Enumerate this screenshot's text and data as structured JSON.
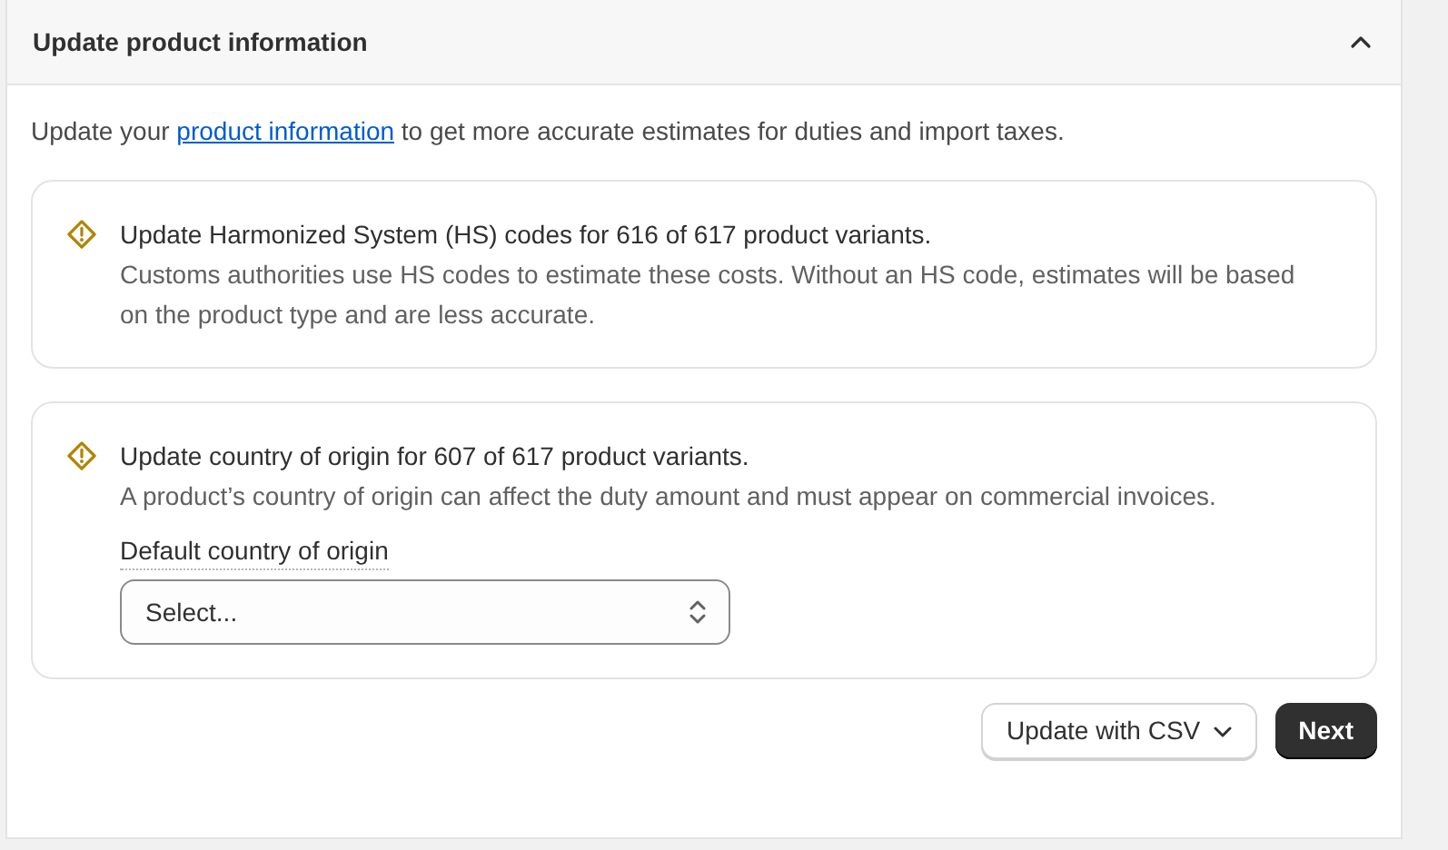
{
  "section": {
    "title": "Update product information",
    "expanded": true
  },
  "intro": {
    "before": "Update your ",
    "link": "product information",
    "after": " to get more accurate estimates for duties and import taxes."
  },
  "notices": [
    {
      "kind": "info",
      "title": "Update Harmonized System (HS) codes for 616 of 617 product variants.",
      "body": "Customs authorities use HS codes to estimate these costs. Without an HS code, estimates will be based on the product type and are less accurate."
    },
    {
      "kind": "select",
      "title": "Update country of origin for 607 of 617 product variants.",
      "body": "A product’s country of origin can affect the duty amount and must appear on commercial invoices.",
      "field_label": "Default country of origin",
      "placeholder": "Select..."
    }
  ],
  "buttons": {
    "secondary": "Update with CSV",
    "primary": "Next"
  }
}
